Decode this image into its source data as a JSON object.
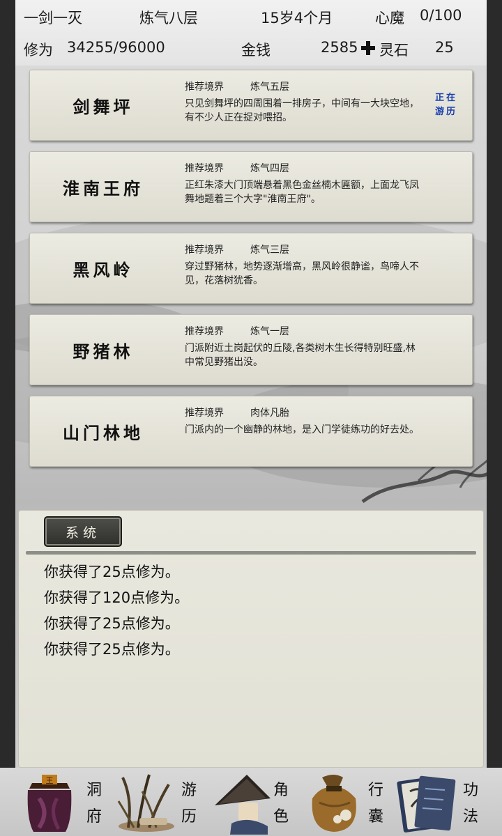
{
  "header": {
    "name": "一剑一灭",
    "realm": "炼气八层",
    "age": "15岁4个月",
    "demon_label": "心魔",
    "demon_value": "0/100",
    "cultivation_label": "修为",
    "cultivation_value": "34255/96000",
    "money_label": "金钱",
    "money_value": "2585",
    "stone_label": "灵石",
    "stone_value": "25"
  },
  "locations": [
    {
      "name": "剑舞坪",
      "realm_label": "推荐境界",
      "realm": "炼气五层",
      "desc": "只见剑舞坪的四周围着一排房子，中间有一大块空地，有不少人正在捉对喂招。",
      "status": "正在游历"
    },
    {
      "name": "淮南王府",
      "realm_label": "推荐境界",
      "realm": "炼气四层",
      "desc": "正红朱漆大门顶端悬着黑色金丝楠木匾额，上面龙飞凤舞地题着三个大字\"淮南王府\"。",
      "status": ""
    },
    {
      "name": "黑风岭",
      "realm_label": "推荐境界",
      "realm": "炼气三层",
      "desc": "穿过野猪林，地势逐渐增高，黑风岭很静谧，鸟啼人不见，花落树犹香。",
      "status": ""
    },
    {
      "name": "野猪林",
      "realm_label": "推荐境界",
      "realm": "炼气一层",
      "desc": "门派附近土岗起伏的丘陵,各类树木生长得特别旺盛,林中常见野猪出没。",
      "status": ""
    },
    {
      "name": "山门林地",
      "realm_label": "推荐境界",
      "realm": "肉体凡胎",
      "desc": "门派内的一个幽静的林地，是入门学徒练功的好去处。",
      "status": ""
    }
  ],
  "system": {
    "tab_label": "系统",
    "messages": [
      "你获得了25点修为。",
      "你获得了120点修为。",
      "你获得了25点修为。",
      "你获得了25点修为。"
    ]
  },
  "nav": [
    {
      "label": "洞府",
      "icon": "cave-dwelling-icon"
    },
    {
      "label": "游历",
      "icon": "travel-grass-icon"
    },
    {
      "label": "角色",
      "icon": "character-hat-icon"
    },
    {
      "label": "行囊",
      "icon": "bag-icon"
    },
    {
      "label": "功法",
      "icon": "scroll-book-icon"
    }
  ],
  "colors": {
    "status_blue": "#1a3fb0",
    "card_bg": "#ecebe2",
    "tab_bg": "#3a3a37"
  }
}
